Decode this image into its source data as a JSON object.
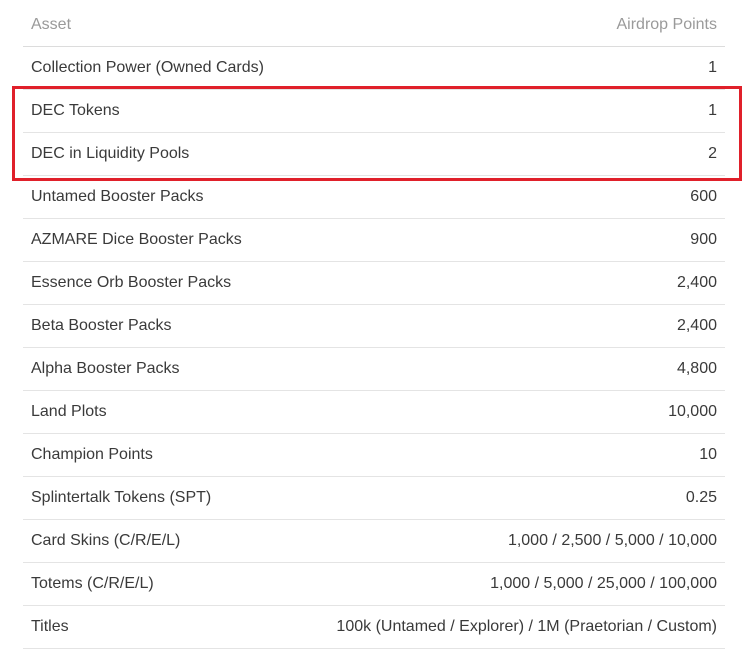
{
  "table": {
    "header": {
      "asset": "Asset",
      "points": "Airdrop Points"
    },
    "rows": [
      {
        "asset": "Collection Power (Owned Cards)",
        "points": "1"
      },
      {
        "asset": "DEC Tokens",
        "points": "1"
      },
      {
        "asset": "DEC in Liquidity Pools",
        "points": "2"
      },
      {
        "asset": "Untamed Booster Packs",
        "points": "600"
      },
      {
        "asset": "AZMARE Dice Booster Packs",
        "points": "900"
      },
      {
        "asset": "Essence Orb Booster Packs",
        "points": "2,400"
      },
      {
        "asset": "Beta Booster Packs",
        "points": "2,400"
      },
      {
        "asset": "Alpha Booster Packs",
        "points": "4,800"
      },
      {
        "asset": "Land Plots",
        "points": "10,000"
      },
      {
        "asset": "Champion Points",
        "points": "10"
      },
      {
        "asset": "Splintertalk Tokens (SPT)",
        "points": "0.25"
      },
      {
        "asset": "Card Skins (C/R/E/L)",
        "points": "1,000 / 2,500 / 5,000 / 10,000"
      },
      {
        "asset": "Totems (C/R/E/L)",
        "points": "1,000 / 5,000 / 25,000 / 100,000"
      },
      {
        "asset": "Titles",
        "points": "100k (Untamed / Explorer) / 1M (Praetorian / Custom)"
      }
    ]
  },
  "highlight": {
    "color": "#e0202a"
  }
}
